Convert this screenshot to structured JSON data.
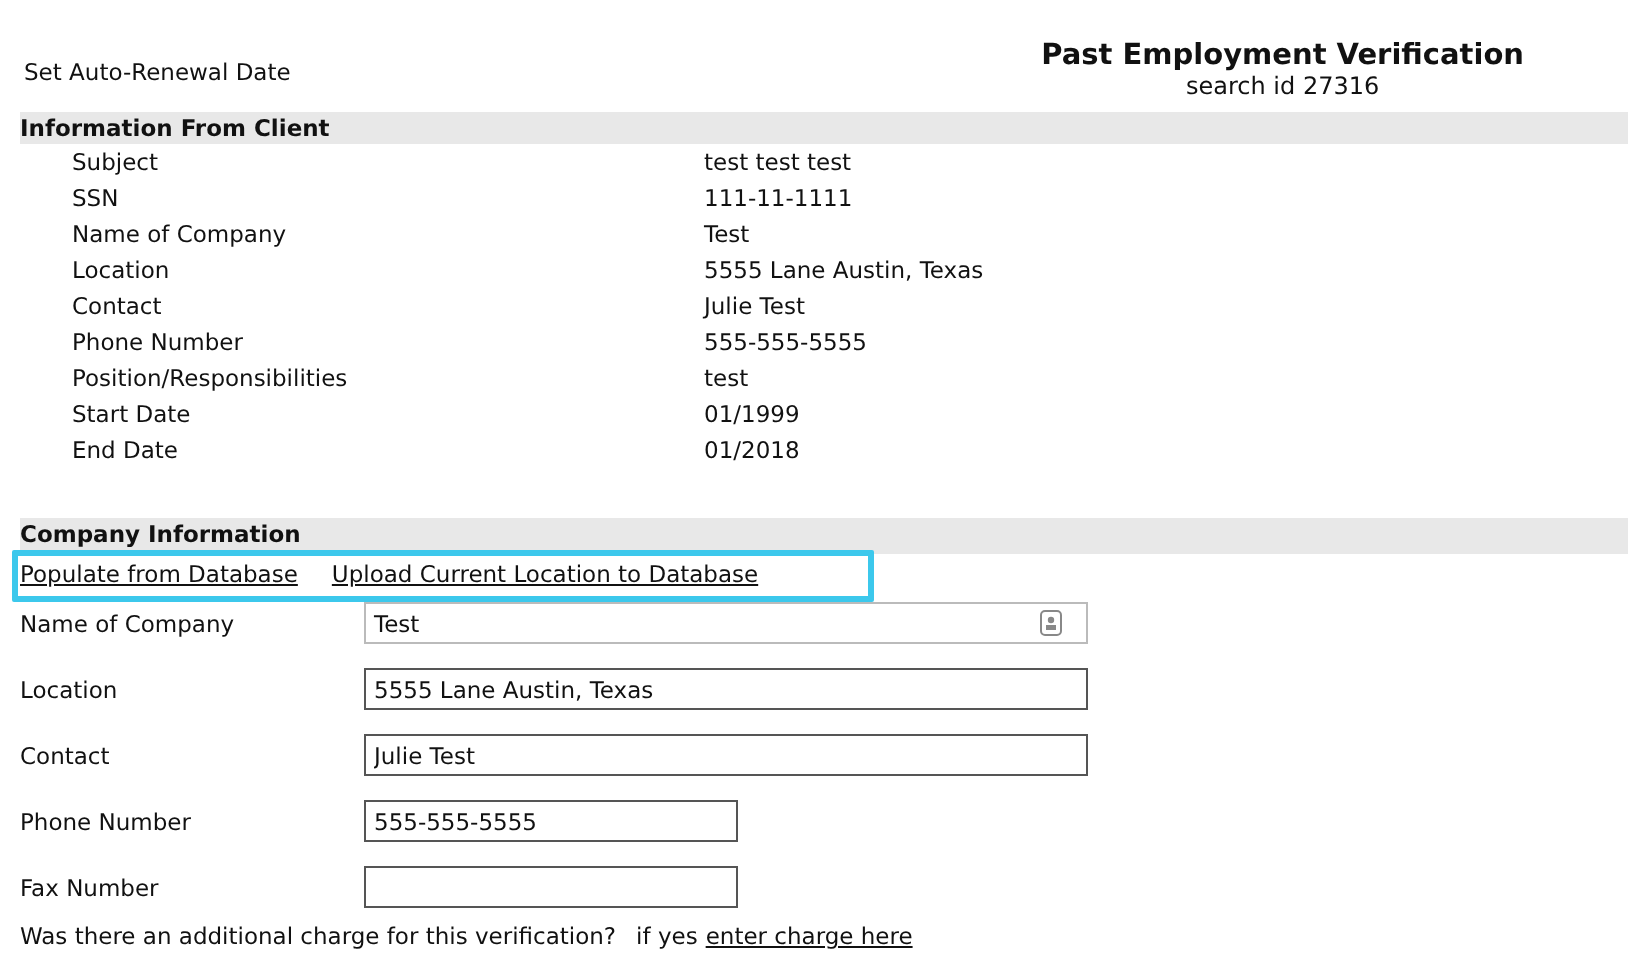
{
  "header": {
    "left_text": "Set Auto-Renewal Date",
    "title": "Past Employment Verification",
    "subtitle": "search id 27316"
  },
  "client_info": {
    "heading": "Information From Client",
    "rows": [
      {
        "label": "Subject",
        "value": "test test test"
      },
      {
        "label": "SSN",
        "value": "111-11-1111"
      },
      {
        "label": "Name of Company",
        "value": "Test"
      },
      {
        "label": "Location",
        "value": "5555 Lane Austin, Texas"
      },
      {
        "label": "Contact",
        "value": "Julie Test"
      },
      {
        "label": "Phone Number",
        "value": "555-555-5555"
      },
      {
        "label": "Position/Responsibilities",
        "value": "test"
      },
      {
        "label": "Start Date",
        "value": "01/1999"
      },
      {
        "label": "End Date",
        "value": "01/2018"
      }
    ]
  },
  "company_info": {
    "heading": "Company Information",
    "links": [
      "Populate from Database",
      "Upload Current Location to Database"
    ],
    "fields": [
      {
        "label": "Name of Company",
        "value": "Test",
        "kind": "lookup"
      },
      {
        "label": "Location",
        "value": "5555 Lane Austin, Texas",
        "kind": "wide"
      },
      {
        "label": "Contact",
        "value": "Julie Test",
        "kind": "wide"
      },
      {
        "label": "Phone Number",
        "value": "555-555-5555",
        "kind": "short"
      },
      {
        "label": "Fax Number",
        "kind": "short"
      }
    ],
    "charge_question": "Was there an additional charge for this verification?",
    "charge_prefix": "if yes",
    "charge_link": "enter charge here"
  }
}
